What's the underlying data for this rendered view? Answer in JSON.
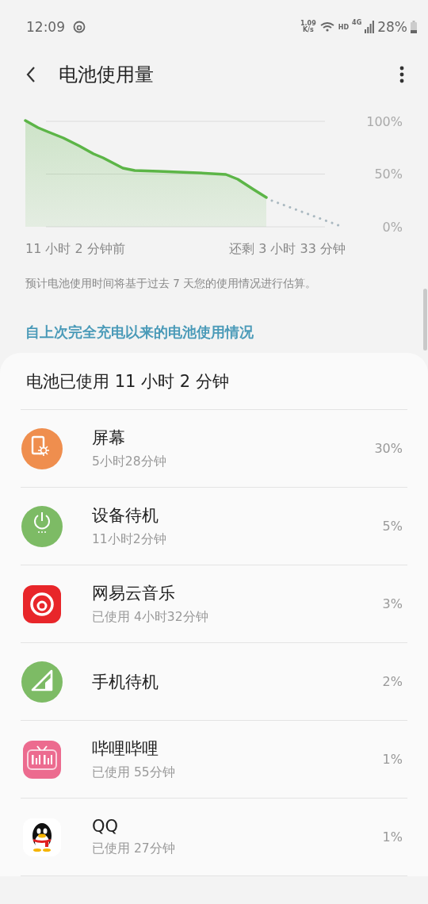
{
  "status_bar": {
    "time": "12:09",
    "speed_value": "1.09",
    "speed_unit": "K/s",
    "network_badge": "HD",
    "network_type": "4G",
    "battery": "28%"
  },
  "app_bar": {
    "title": "电池使用量"
  },
  "chart": {
    "start_label": "11 小时 2 分钟前",
    "end_label": "还剩 3 小时 33 分钟",
    "y_labels": [
      "100%",
      "50%",
      "0%"
    ]
  },
  "note": "预计电池使用时间将基于过去 7 天您的使用情况进行估算。",
  "section_title": "自上次完全充电以来的电池使用情况",
  "usage": {
    "total": "电池已使用 11 小时 2 分钟",
    "items": [
      {
        "kind": "screen",
        "color": "#ef8e4e",
        "name": "屏幕",
        "detail": "5小时28分钟",
        "percent": "30%"
      },
      {
        "kind": "power",
        "color": "#7dbb65",
        "name": "设备待机",
        "detail": "11小时2分钟",
        "percent": "5%"
      },
      {
        "kind": "music",
        "color": "#e8262a",
        "name": "网易云音乐",
        "detail": "已使用 4小时32分钟",
        "percent": "3%"
      },
      {
        "kind": "signal",
        "color": "#7dbb65",
        "name": "手机待机",
        "percent": "2%"
      },
      {
        "kind": "tv",
        "color": "#ec6b8f",
        "name": "哔哩哔哩",
        "detail": "已使用 55分钟",
        "percent": "1%"
      },
      {
        "kind": "penguin",
        "color": "#ffffff",
        "name": "QQ",
        "detail": "已使用 27分钟",
        "percent": "1%"
      }
    ]
  }
}
